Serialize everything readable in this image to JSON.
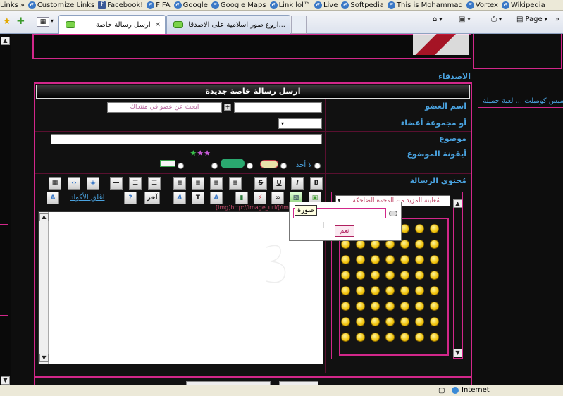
{
  "links_bar": {
    "items": [
      "Links",
      "Customize Links",
      "Facebook!",
      "FIFA",
      "Google",
      "Google Maps",
      "Link lol™",
      "Live",
      "Softpedia",
      "This is Mohammad",
      "Vortex",
      "Wikipedia"
    ]
  },
  "tabs": [
    {
      "label": "ارسل رسالة خاصة",
      "active": true
    },
    {
      "label": "اروع صور اسلامية على الاصدقا...",
      "active": false
    }
  ],
  "commands": {
    "page": "Page"
  },
  "sidebar": {
    "friends_heading": "الاصدقاء",
    "link_text": "ميس كومبلت ... لعبة جميلة"
  },
  "form": {
    "title": "ارسل رسالة خاصة جديدة",
    "member_label": "اسم العضو",
    "member_search_placeholder": "ابحث عن عضو في منتداك",
    "group_label": "أو مجموعة أعضاء",
    "subject_label": "موضوع",
    "icon_label": "أيقونة الموضوع",
    "icon_none": "لا أحد",
    "message_label": "مُحتوى الرسالة"
  },
  "toolbar": {
    "bold": "B",
    "italic": "I",
    "underline": "U",
    "strike": "S",
    "more": "آخر",
    "close_tags": "اغلق الأكواد",
    "hint_text": "[img]http://image_url/[/img]"
  },
  "smilies": {
    "dropdown_value": "مُعاينة المزيد من الوجوه الضاحكة"
  },
  "image_popup": {
    "tooltip": "صورة",
    "confirm": "نعم"
  },
  "status": {
    "internet": "Internet"
  }
}
